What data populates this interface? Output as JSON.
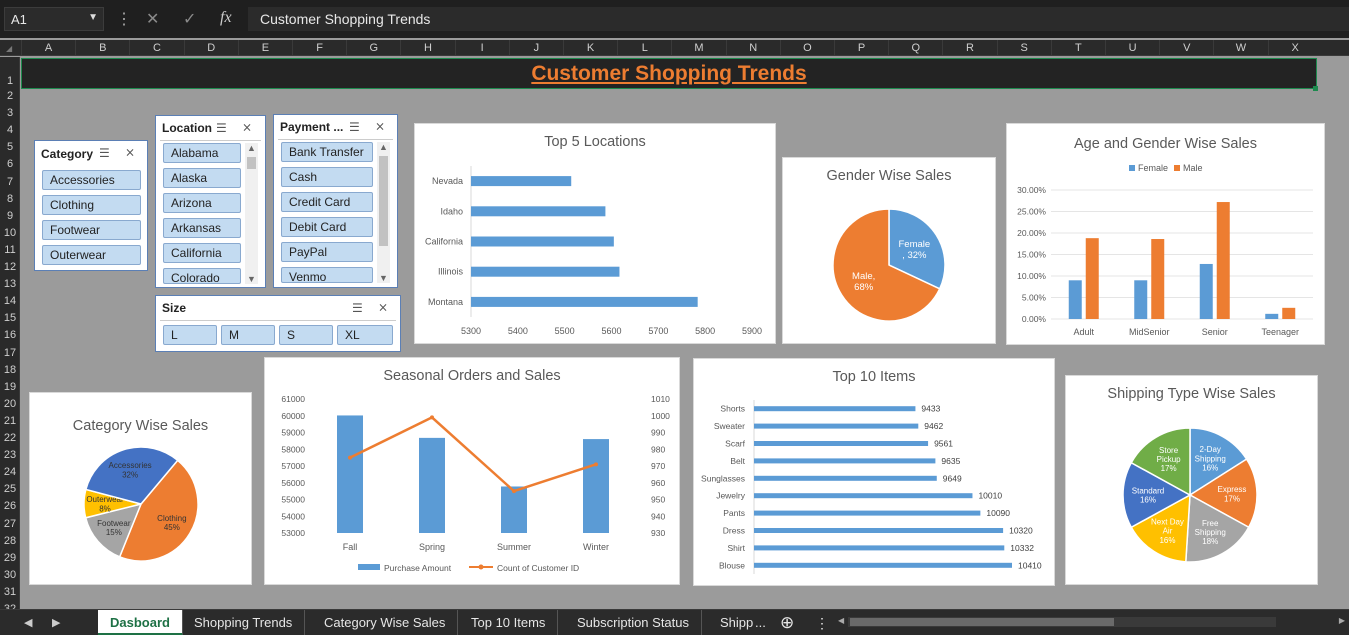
{
  "formula_bar": {
    "name_box": "A1",
    "formula": "Customer Shopping Trends"
  },
  "columns": [
    "A",
    "B",
    "C",
    "D",
    "E",
    "F",
    "G",
    "H",
    "I",
    "J",
    "K",
    "L",
    "M",
    "N",
    "O",
    "P",
    "Q",
    "R",
    "S",
    "T",
    "U",
    "V",
    "W",
    "X"
  ],
  "rows": [
    "1",
    "2",
    "3",
    "4",
    "5",
    "6",
    "7",
    "8",
    "9",
    "10",
    "11",
    "12",
    "13",
    "14",
    "15",
    "16",
    "17",
    "18",
    "19",
    "20",
    "21",
    "22",
    "23",
    "24",
    "25",
    "26",
    "27",
    "28",
    "29",
    "30",
    "31",
    "32"
  ],
  "dashboard_title": "Customer Shopping Trends",
  "slicers": {
    "category": {
      "title": "Category",
      "items": [
        "Accessories",
        "Clothing",
        "Footwear",
        "Outerwear"
      ]
    },
    "location": {
      "title": "Location",
      "items": [
        "Alabama",
        "Alaska",
        "Arizona",
        "Arkansas",
        "California",
        "Colorado"
      ]
    },
    "payment": {
      "title": "Payment ...",
      "items": [
        "Bank Transfer",
        "Cash",
        "Credit Card",
        "Debit Card",
        "PayPal",
        "Venmo"
      ]
    },
    "size": {
      "title": "Size",
      "items": [
        "L",
        "M",
        "S",
        "XL"
      ]
    }
  },
  "chart_data": [
    {
      "id": "top5",
      "type": "bar",
      "title": "Top 5 Locations",
      "orientation": "horizontal",
      "categories": [
        "Nevada",
        "Idaho",
        "California",
        "Illinois",
        "Montana"
      ],
      "values": [
        5514,
        5587,
        5605,
        5617,
        5784
      ],
      "xlim": [
        5300,
        5900
      ],
      "xticks": [
        "5300",
        "5400",
        "5500",
        "5600",
        "5700",
        "5800",
        "5900"
      ],
      "color": "#5b9bd5"
    },
    {
      "id": "gender",
      "type": "pie",
      "title": "Gender Wise Sales",
      "slices": [
        {
          "name": "Female",
          "value": 32,
          "label": "Female\n, 32%",
          "color": "#5b9bd5"
        },
        {
          "name": "Male",
          "value": 68,
          "label": "Male,\n68%",
          "color": "#ed7d31"
        }
      ]
    },
    {
      "id": "agegender",
      "type": "bar",
      "title": "Age and Gender Wise Sales",
      "categories": [
        "Adult",
        "MidSenior",
        "Senior",
        "Teenager"
      ],
      "series": [
        {
          "name": "Female",
          "values": [
            0.09,
            0.09,
            0.128,
            0.012
          ],
          "color": "#5b9bd5"
        },
        {
          "name": "Male",
          "values": [
            0.188,
            0.186,
            0.272,
            0.026
          ],
          "color": "#ed7d31"
        }
      ],
      "ylim": [
        0,
        0.3
      ],
      "yticks": [
        "0.00%",
        "5.00%",
        "10.00%",
        "15.00%",
        "20.00%",
        "25.00%",
        "30.00%"
      ],
      "legend": "top"
    },
    {
      "id": "category",
      "type": "pie",
      "title": "Category Wise Sales",
      "slices": [
        {
          "name": "Clothing",
          "value": 45,
          "label": "Clothing\n45%",
          "color": "#ed7d31"
        },
        {
          "name": "Footwear",
          "value": 15,
          "label": "Footwear\n15%",
          "color": "#a5a5a5"
        },
        {
          "name": "Outerwear",
          "value": 8,
          "label": "Outerwear\n8%",
          "color": "#ffc000"
        },
        {
          "name": "Accessories",
          "value": 32,
          "label": "Accessories\n32%",
          "color": "#4472c4"
        }
      ]
    },
    {
      "id": "seasonal",
      "type": "bar",
      "title": "Seasonal Orders and Sales",
      "categories": [
        "Fall",
        "Spring",
        "Summer",
        "Winter"
      ],
      "series": [
        {
          "name": "Purchase Amount",
          "type": "bar",
          "axis": "left",
          "values": [
            60018,
            58679,
            55777,
            58607
          ],
          "color": "#5b9bd5"
        },
        {
          "name": "Count of Customer ID",
          "type": "line",
          "axis": "right",
          "values": [
            975,
            999,
            955,
            971
          ],
          "color": "#ed7d31"
        }
      ],
      "ylim": [
        53000,
        61000
      ],
      "yticks": [
        "53000",
        "54000",
        "55000",
        "56000",
        "57000",
        "58000",
        "59000",
        "60000",
        "61000"
      ],
      "y2lim": [
        930,
        1010
      ],
      "y2ticks": [
        "930",
        "940",
        "950",
        "960",
        "970",
        "980",
        "990",
        "1000",
        "1010"
      ],
      "legend": "bottom"
    },
    {
      "id": "top10",
      "type": "bar",
      "title": "Top 10 Items",
      "orientation": "horizontal",
      "categories": [
        "Shorts",
        "Sweater",
        "Scarf",
        "Belt",
        "Sunglasses",
        "Jewelry",
        "Pants",
        "Dress",
        "Shirt",
        "Blouse"
      ],
      "values": [
        9433,
        9462,
        9561,
        9635,
        9649,
        10010,
        10090,
        10320,
        10332,
        10410
      ],
      "labels": [
        "9433",
        "9462",
        "9561",
        "9635",
        "9649",
        "10010",
        "10090",
        "10320",
        "10332",
        "10410"
      ],
      "color": "#5b9bd5"
    },
    {
      "id": "shipping",
      "type": "pie",
      "title": "Shipping Type Wise Sales",
      "slices": [
        {
          "name": "2-Day Shipping",
          "value": 16,
          "label": "2-Day\nShipping\n16%",
          "color": "#5b9bd5"
        },
        {
          "name": "Express",
          "value": 17,
          "label": "Express\n17%",
          "color": "#ed7d31"
        },
        {
          "name": "Free Shipping",
          "value": 18,
          "label": "Free\nShipping\n18%",
          "color": "#a5a5a5"
        },
        {
          "name": "Next Day Air",
          "value": 16,
          "label": "Next Day\nAir\n16%",
          "color": "#ffc000"
        },
        {
          "name": "Standard",
          "value": 16,
          "label": "Standard\n16%",
          "color": "#4472c4"
        },
        {
          "name": "Store Pickup",
          "value": 17,
          "label": "Store\nPickup\n17%",
          "color": "#70ad47"
        }
      ]
    }
  ],
  "tabs": [
    "Dasboard",
    "Shopping Trends",
    "Category Wise Sales",
    "Top 10 Items",
    "Subscription Status",
    "Shipp"
  ],
  "active_tab": "Dasboard",
  "tab_overflow": "..."
}
